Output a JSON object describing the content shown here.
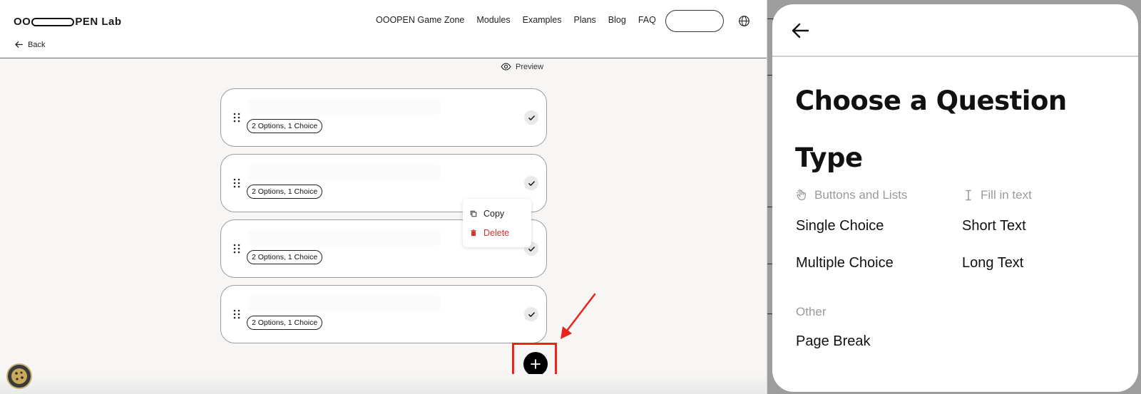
{
  "header": {
    "logo": {
      "prefix": "OO",
      "suffix": "PEN Lab"
    },
    "back_label": "Back",
    "nav_items": [
      "OOOPEN Game Zone",
      "Modules",
      "Examples",
      "Plans",
      "Blog",
      "FAQ"
    ]
  },
  "editor": {
    "preview_label": "Preview",
    "cards": [
      {
        "badge": "2 Options, 1 Choice"
      },
      {
        "badge": "2 Options, 1 Choice"
      },
      {
        "badge": "2 Options, 1 Choice"
      },
      {
        "badge": "2 Options, 1 Choice"
      }
    ],
    "context_menu": {
      "copy": "Copy",
      "delete": "Delete"
    }
  },
  "modal": {
    "title": "Choose a Question Type",
    "categories": {
      "buttons_lists": {
        "label": "Buttons and Lists",
        "icon": "hand-pointer-icon",
        "items": [
          "Single Choice",
          "Multiple Choice"
        ]
      },
      "fill_in": {
        "label": "Fill in text",
        "icon": "text-cursor-icon",
        "items": [
          "Short Text",
          "Long Text"
        ]
      },
      "other": {
        "label": "Other",
        "items": [
          "Page Break"
        ]
      }
    }
  },
  "colors": {
    "annotation_red": "#e8241c",
    "delete_red": "#d2322d",
    "background": "#f7f6f4"
  }
}
